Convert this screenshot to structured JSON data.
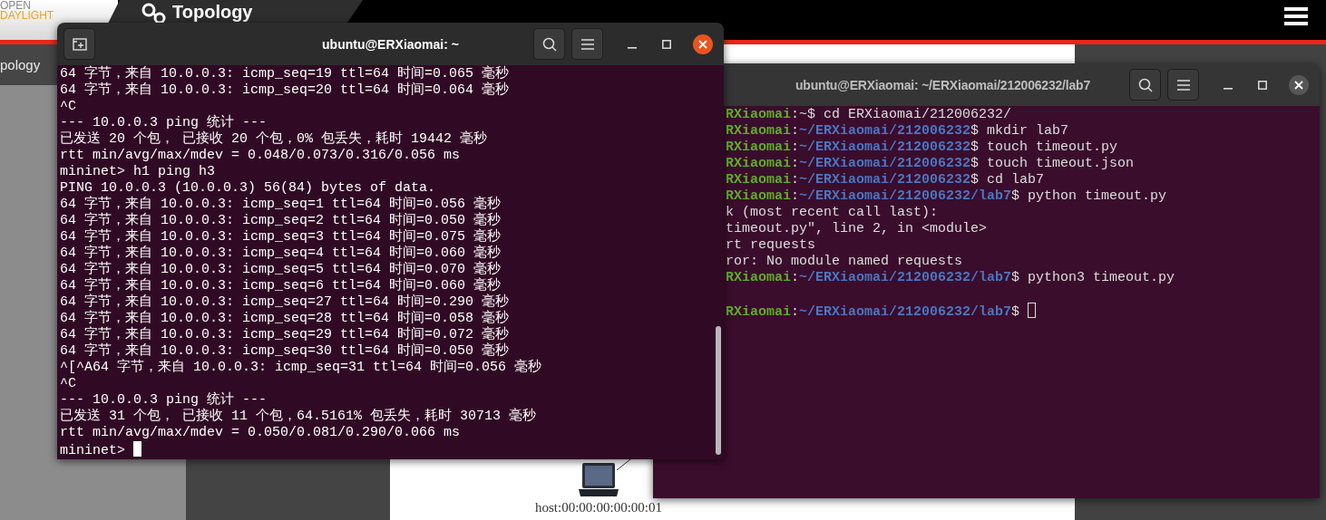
{
  "web_page": {
    "logo": {
      "line_1": "OPEN",
      "line_2": "DAYLIGHT"
    },
    "header_tab": "Topology",
    "sidebar": {
      "items": [
        {
          "label": "pology",
          "selected": true
        }
      ]
    },
    "topology": {
      "nodes": [
        {
          "label": "host:00:00:00:00:00:01"
        }
      ]
    }
  },
  "windows": [
    {
      "title": "ubuntu@ERXiaomai: ~",
      "focused": true,
      "lines": [
        {
          "kind": "output",
          "text": "64 字节，来自 10.0.0.3: icmp_seq=19 ttl=64 时间=0.065 毫秒"
        },
        {
          "kind": "output",
          "text": "64 字节，来自 10.0.0.3: icmp_seq=20 ttl=64 时间=0.064 毫秒"
        },
        {
          "kind": "output",
          "text": "^C"
        },
        {
          "kind": "output",
          "text": "--- 10.0.0.3 ping 统计 ---"
        },
        {
          "kind": "output",
          "text": "已发送 20 个包， 已接收 20 个包，0% 包丢失，耗时 19442 毫秒"
        },
        {
          "kind": "output",
          "text": "rtt min/avg/max/mdev = 0.048/0.073/0.316/0.056 ms"
        },
        {
          "kind": "output",
          "text": "mininet> h1 ping h3"
        },
        {
          "kind": "output",
          "text": "PING 10.0.0.3 (10.0.0.3) 56(84) bytes of data."
        },
        {
          "kind": "output",
          "text": "64 字节，来自 10.0.0.3: icmp_seq=1 ttl=64 时间=0.056 毫秒"
        },
        {
          "kind": "output",
          "text": "64 字节，来自 10.0.0.3: icmp_seq=2 ttl=64 时间=0.050 毫秒"
        },
        {
          "kind": "output",
          "text": "64 字节，来自 10.0.0.3: icmp_seq=3 ttl=64 时间=0.075 毫秒"
        },
        {
          "kind": "output",
          "text": "64 字节，来自 10.0.0.3: icmp_seq=4 ttl=64 时间=0.060 毫秒"
        },
        {
          "kind": "output",
          "text": "64 字节，来自 10.0.0.3: icmp_seq=5 ttl=64 时间=0.070 毫秒"
        },
        {
          "kind": "output",
          "text": "64 字节，来自 10.0.0.3: icmp_seq=6 ttl=64 时间=0.060 毫秒"
        },
        {
          "kind": "output",
          "text": "64 字节，来自 10.0.0.3: icmp_seq=27 ttl=64 时间=0.290 毫秒"
        },
        {
          "kind": "output",
          "text": "64 字节，来自 10.0.0.3: icmp_seq=28 ttl=64 时间=0.058 毫秒"
        },
        {
          "kind": "output",
          "text": "64 字节，来自 10.0.0.3: icmp_seq=29 ttl=64 时间=0.072 毫秒"
        },
        {
          "kind": "output",
          "text": "64 字节，来自 10.0.0.3: icmp_seq=30 ttl=64 时间=0.050 毫秒"
        },
        {
          "kind": "output",
          "text": "^[^A64 字节，来自 10.0.0.3: icmp_seq=31 ttl=64 时间=0.056 毫秒"
        },
        {
          "kind": "output",
          "text": "^C"
        },
        {
          "kind": "output",
          "text": "--- 10.0.0.3 ping 统计 ---"
        },
        {
          "kind": "output",
          "text": "已发送 31 个包， 已接收 11 个包，64.5161% 包丢失，耗时 30713 毫秒"
        },
        {
          "kind": "output",
          "text": "rtt min/avg/max/mdev = 0.050/0.081/0.290/0.066 ms"
        },
        {
          "kind": "output",
          "text": "mininet>",
          "cursor": true
        }
      ]
    },
    {
      "title": "ubuntu@ERXiaomai: ~/ERXiaomai/212006232/lab7",
      "focused": false,
      "lines": [
        {
          "kind": "prompt",
          "segments": [
            {
              "text": "RXiaomai",
              "kind": "user"
            },
            {
              "text": ":~$ cd ERXiaomai/212006232/",
              "kind": "plain"
            }
          ]
        },
        {
          "kind": "prompt",
          "segments": [
            {
              "text": "RXiaomai",
              "kind": "user"
            },
            {
              "text": ":",
              "kind": "plain"
            },
            {
              "text": "~/ERXiaomai/212006232",
              "kind": "path"
            },
            {
              "text": "$ mkdir lab7",
              "kind": "plain"
            }
          ]
        },
        {
          "kind": "prompt",
          "segments": [
            {
              "text": "RXiaomai",
              "kind": "user"
            },
            {
              "text": ":",
              "kind": "plain"
            },
            {
              "text": "~/ERXiaomai/212006232",
              "kind": "path"
            },
            {
              "text": "$ touch timeout.py",
              "kind": "plain"
            }
          ]
        },
        {
          "kind": "prompt",
          "segments": [
            {
              "text": "RXiaomai",
              "kind": "user"
            },
            {
              "text": ":",
              "kind": "plain"
            },
            {
              "text": "~/ERXiaomai/212006232",
              "kind": "path"
            },
            {
              "text": "$ touch timeout.json",
              "kind": "plain"
            }
          ]
        },
        {
          "kind": "prompt",
          "segments": [
            {
              "text": "RXiaomai",
              "kind": "user"
            },
            {
              "text": ":",
              "kind": "plain"
            },
            {
              "text": "~/ERXiaomai/212006232",
              "kind": "path"
            },
            {
              "text": "$ cd lab7",
              "kind": "plain"
            }
          ]
        },
        {
          "kind": "prompt",
          "segments": [
            {
              "text": "RXiaomai",
              "kind": "user"
            },
            {
              "text": ":",
              "kind": "plain"
            },
            {
              "text": "~/ERXiaomai/212006232/lab7",
              "kind": "path"
            },
            {
              "text": "$ python timeout.py",
              "kind": "plain"
            }
          ]
        },
        {
          "kind": "output",
          "text": "k (most recent call last):"
        },
        {
          "kind": "output",
          "text": "timeout.py\", line 2, in <module>"
        },
        {
          "kind": "output",
          "text": "rt requests"
        },
        {
          "kind": "output",
          "text": "ror: No module named requests"
        },
        {
          "kind": "prompt",
          "segments": [
            {
              "text": "RXiaomai",
              "kind": "user"
            },
            {
              "text": ":",
              "kind": "plain"
            },
            {
              "text": "~/ERXiaomai/212006232/lab7",
              "kind": "path"
            },
            {
              "text": "$ python3 timeout.py",
              "kind": "plain"
            }
          ]
        },
        {
          "kind": "blank"
        },
        {
          "kind": "prompt",
          "cursor": true,
          "segments": [
            {
              "text": "RXiaomai",
              "kind": "user"
            },
            {
              "text": ":",
              "kind": "plain"
            },
            {
              "text": "~/ERXiaomai/212006232/lab7",
              "kind": "path"
            },
            {
              "text": "$",
              "kind": "plain"
            }
          ]
        }
      ]
    }
  ]
}
